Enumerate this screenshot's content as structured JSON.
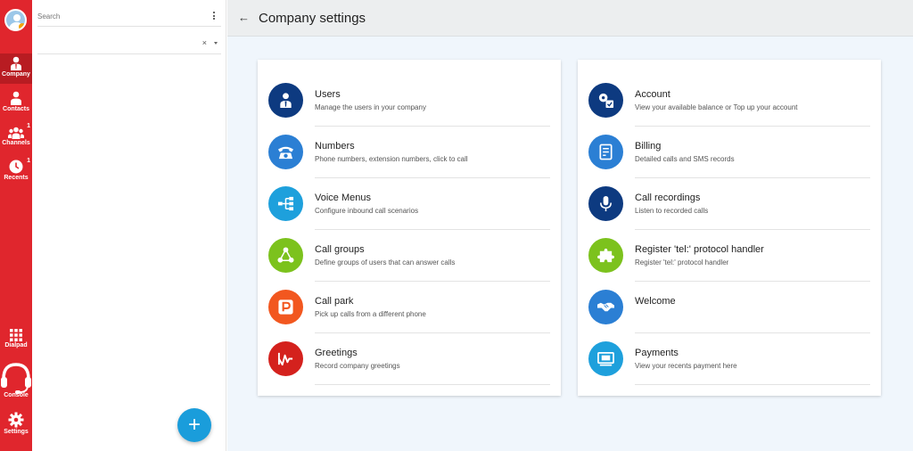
{
  "rail": {
    "items": [
      {
        "label": "Company",
        "badge": ""
      },
      {
        "label": "Contacts",
        "badge": ""
      },
      {
        "label": "Channels",
        "badge": "1"
      },
      {
        "label": "Recents",
        "badge": "1"
      },
      {
        "label": "Dialpad",
        "badge": ""
      },
      {
        "label": "Console",
        "badge": ""
      },
      {
        "label": "Settings",
        "badge": ""
      }
    ]
  },
  "panel": {
    "search_placeholder": "Search",
    "clear_glyph": "×",
    "fab_glyph": "+"
  },
  "header": {
    "back_glyph": "←",
    "title": "Company settings"
  },
  "left_card": [
    {
      "title": "Users",
      "subtitle": "Manage the users in your company",
      "color": "#0d3a80",
      "icon": "user-tie-icon"
    },
    {
      "title": "Numbers",
      "subtitle": "Phone numbers, extension numbers, click to call",
      "color": "#2b7fd4",
      "icon": "telephone-icon"
    },
    {
      "title": "Voice Menus",
      "subtitle": "Configure inbound call scenarios",
      "color": "#1ea0dc",
      "icon": "sitemap-icon"
    },
    {
      "title": "Call groups",
      "subtitle": "Define groups of users that can answer calls",
      "color": "#7cc21d",
      "icon": "group-triangle-icon"
    },
    {
      "title": "Call park",
      "subtitle": "Pick up calls from a different phone",
      "color": "#f2571f",
      "icon": "parking-icon"
    },
    {
      "title": "Greetings",
      "subtitle": "Record company greetings",
      "color": "#d4211d",
      "icon": "waveform-icon"
    }
  ],
  "right_card": [
    {
      "title": "Account",
      "subtitle": "View your available balance or Top up your account",
      "color": "#0d3a80",
      "icon": "account-gear-icon"
    },
    {
      "title": "Billing",
      "subtitle": "Detailed calls and SMS records",
      "color": "#2b7fd4",
      "icon": "receipt-icon"
    },
    {
      "title": "Call recordings",
      "subtitle": "Listen to recorded calls",
      "color": "#0d3a80",
      "icon": "microphone-icon"
    },
    {
      "title": "Register 'tel:' protocol handler",
      "subtitle": "Register 'tel:' protocol handler",
      "color": "#7cc21d",
      "icon": "puzzle-icon"
    },
    {
      "title": "Welcome",
      "subtitle": "",
      "color": "#2b7fd4",
      "icon": "handshake-icon"
    },
    {
      "title": "Payments",
      "subtitle": "View your recents payment here",
      "color": "#1ea0dc",
      "icon": "payment-card-icon"
    }
  ]
}
